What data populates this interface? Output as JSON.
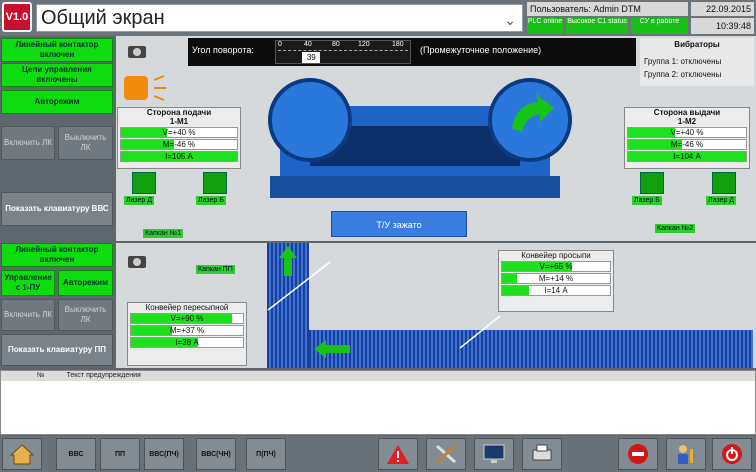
{
  "header": {
    "logo": "V1.0",
    "title": "Общий экран",
    "user": "Пользователь: Admin DTM",
    "date": "22.09.2015",
    "time": "10:39:48",
    "status": [
      "PLC online",
      "Высокое  С1 status",
      "СУ в  работе"
    ]
  },
  "left_top": {
    "contactor": "Линейный контактор включен",
    "chains": "Цепи управления включены",
    "auto": "Авторежим",
    "enable_lk": "Включить ЛК",
    "disable_lk": "Выключить ЛК",
    "keyboard": "Показать клавиатуру ВВС"
  },
  "left_bottom": {
    "contactor": "Линейный контактор включен",
    "control": "Управление с 1-ПУ",
    "auto": "Авторежим",
    "enable_lk": "Включить ЛК",
    "disable_lk": "Выключить ЛК",
    "keyboard": "Показать клавиатуру ПП"
  },
  "angle": {
    "label": "Угол поворота:",
    "ticks": [
      "0",
      "40",
      "80",
      "120",
      "180"
    ],
    "value": "39",
    "value_num": 39,
    "max": 180,
    "state": "(Промежуточное положение)"
  },
  "vibrators": {
    "title": "Вибраторы",
    "g1": "Группа 1:  отключены",
    "g2": "Группа 2:  отключены"
  },
  "feed": {
    "title": "Сторона подачи",
    "sub": "1-М1",
    "v": "V=+40 %",
    "v_pct": 40,
    "m": "M=-46 %",
    "m_pct": 46,
    "i": "I=105 А",
    "i_pct": 100,
    "lamp_l": "Лазер Д",
    "lamp_r": "Лазер Б",
    "lock": "Капкан №1"
  },
  "out": {
    "title": "Сторона выдачи",
    "sub": "1-М2",
    "v": "V=+40 %",
    "v_pct": 40,
    "m": "M=-46 %",
    "m_pct": 46,
    "i": "I=104 А",
    "i_pct": 100,
    "lamp_l": "Лазер Б",
    "lamp_r": "Лазер Д",
    "lock": "Капкан №2"
  },
  "tu_button": "Т/У зажато",
  "kapkan_pp": "Капкан ПП",
  "conv_spill": {
    "title": "Конвейер просыпи",
    "v": "V=+65 %",
    "v_pct": 65,
    "m": "M=+14 %",
    "m_pct": 14,
    "i": "I=14 А",
    "i_pct": 25
  },
  "conv_reload": {
    "title": "Конвейер пересыпной",
    "v": "V=+90 %",
    "v_pct": 90,
    "m": "M=+37 %",
    "m_pct": 37,
    "i": "I=38 А",
    "i_pct": 60
  },
  "alarm": {
    "col_no": "№",
    "col_text": "Текст предупреждения"
  },
  "toolbar": [
    "home-icon",
    "ВВС",
    "ПП",
    "ВВС(ПЧ)",
    "ВВС(ЧН)",
    "П(ПЧ)",
    "warning-icon",
    "tools-icon",
    "monitor-icon",
    "printer-icon",
    "stop-icon",
    "user-key-icon",
    "power-icon"
  ],
  "toolbar_labels": {
    "vvs": "ВВС",
    "pp": "ПП",
    "vvs_pch": "ВВС(ПЧ)",
    "vvs_chn": "ВВС(ЧН)",
    "p_pch": "П(ПЧ)"
  }
}
